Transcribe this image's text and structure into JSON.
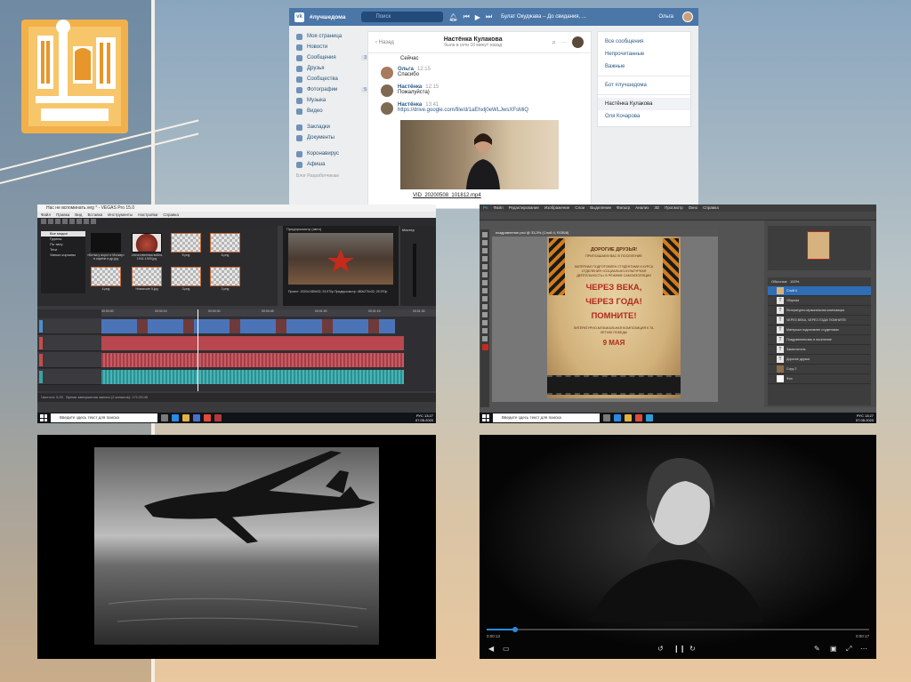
{
  "vk": {
    "brand": "#лучшедома",
    "search_placeholder": "Поиск",
    "track": "Булат Окуджава – До свидания, ...",
    "user_name": "Ольга",
    "sidebar": [
      {
        "label": "Моя страница",
        "count": ""
      },
      {
        "label": "Новости",
        "count": ""
      },
      {
        "label": "Сообщения",
        "count": "3"
      },
      {
        "label": "Друзья",
        "count": ""
      },
      {
        "label": "Сообщества",
        "count": ""
      },
      {
        "label": "Фотографии",
        "count": "5"
      },
      {
        "label": "Музыка",
        "count": ""
      },
      {
        "label": "Видео",
        "count": ""
      }
    ],
    "sidebar2": [
      {
        "label": "Закладки"
      },
      {
        "label": "Документы"
      }
    ],
    "sidebar3": [
      {
        "label": "Коронавирус"
      },
      {
        "label": "Афиша"
      }
    ],
    "sidebar_footer": "Блог  Разработчикам",
    "chat": {
      "back": "Назад",
      "title": "Настёнка Кулакова",
      "status": "была в сети 10 минут назад",
      "first_line": "Сейчас",
      "messages": [
        {
          "author": "Ольга",
          "time": "12:15",
          "text": "Спасибо",
          "link": ""
        },
        {
          "author": "Настёнка",
          "time": "12:15",
          "text": "Пожалуйста)",
          "link": ""
        },
        {
          "author": "Настёнка",
          "time": "13:41",
          "text": "",
          "link": "https://drive.google.com/file/d/1aEhxlj0eWLJwsXFsMiQ"
        }
      ],
      "file_name": "VID_20200508_101812.mp4"
    },
    "right": {
      "all": "Все сообщения",
      "unread": "Непрочитанные",
      "important": "Важные",
      "bot": "Бот #лучшедома",
      "active": "Настёнка Кулакова",
      "other": "Оля Кочарова"
    }
  },
  "vegas": {
    "title": "Нас не вспоминать.veg * - VEGAS Pro 15.0",
    "menu": [
      "Файл",
      "Правка",
      "Вид",
      "Вставка",
      "Инструменты",
      "Настройки",
      "Справка"
    ],
    "tree": [
      "Все медиа",
      "Группы",
      "По типу",
      "Теги",
      "Умные корзины"
    ],
    "thumbs": [
      {
        "cap": "«Битва у ворот в Москву» в сирени и др.jpg",
        "kind": "dark"
      },
      {
        "cap": "отечественная война 1941-1945.jpg",
        "kind": "red"
      },
      {
        "cap": "5.png",
        "kind": "check"
      },
      {
        "cap": "6.png",
        "kind": "check"
      },
      {
        "cap": "4.png",
        "kind": "check"
      },
      {
        "cap": "Новая кин 5.jpg",
        "kind": "check"
      },
      {
        "cap": "3.png",
        "kind": "check"
      },
      {
        "cap": "2.png",
        "kind": "check"
      }
    ],
    "preview_label": "Предпросмотр (авто)",
    "preview_meta": "Проект: 1920x1080x32; 29,970p   Предпросмотр: 480x270x32; 29,970p",
    "mixer_label": "Мастер",
    "ruler": [
      "00:00:00",
      "00:00:15",
      "00:00:30",
      "00:00:45",
      "00:01:00",
      "00:01:15",
      "00:01:30"
    ],
    "status": "Частота: 0,00",
    "time_status": "Время завершения записи (2 каналов): 171:25:45"
  },
  "ps": {
    "menu": [
      "Файл",
      "Редактирование",
      "Изображение",
      "Слои",
      "Выделение",
      "Фильтр",
      "Анализ",
      "3D",
      "Просмотр",
      "Окно",
      "Справка"
    ],
    "doc_tab": "поздравление.psd @ 33,3% (Слой 4, RGB/8)",
    "poster": {
      "greeting": "ДОРОГИЕ ДРУЗЬЯ!",
      "invite": "ПРИГЛАШАЕМ ВАС В ПОСЕЛЕНИЕ",
      "body": "МАТЕРИАЛ ПОДГОТОВЛЕН СТУДЕНТАМИ 4 КУРСА ОТДЕЛЕНИЯ «СОЦИАЛЬНО-КУЛЬТУРНАЯ ДЕЯТЕЛЬНОСТЬ» В РЕЖИМЕ САМОИЗОЛЯЦИИ",
      "big1": "ЧЕРЕЗ ВЕКА,",
      "big2": "ЧЕРЕЗ ГОДА!",
      "big3": "ПОМНИТЕ!",
      "small": "ЛИТЕРАТУРНО-МУЗЫКАЛЬНАЯ КОМПОЗИЦИЯ К 75-ЛЕТИЮ ПОБЕДЫ",
      "date": "9 МАЯ"
    },
    "layers": [
      "Слой 4",
      "Уборная",
      "Литературно-музыкальная композиция",
      "ЧЕРЕЗ ВЕКА, ЧЕРЕЗ ГОДА! ПОМНИТЕ!",
      "Материал подготовлен студентами",
      "Поздравляем вас в поселение",
      "Заместитель",
      "Дорогие друзья",
      "Copy 2",
      "Фон"
    ],
    "blend": "Обычные",
    "opacity": "100%"
  },
  "player": {
    "time_left": "0:00:13",
    "time_right": "0:00:17"
  },
  "taskbar": {
    "search_placeholder": "Введите здесь текст для поиска",
    "lang": "РУС",
    "time": "13:27",
    "date": "07.05.2020"
  },
  "colors": {
    "vk_blue": "#4a76a8",
    "ps_layer_selected": "#2f6db5",
    "player_progress": "#2b8ae2"
  }
}
